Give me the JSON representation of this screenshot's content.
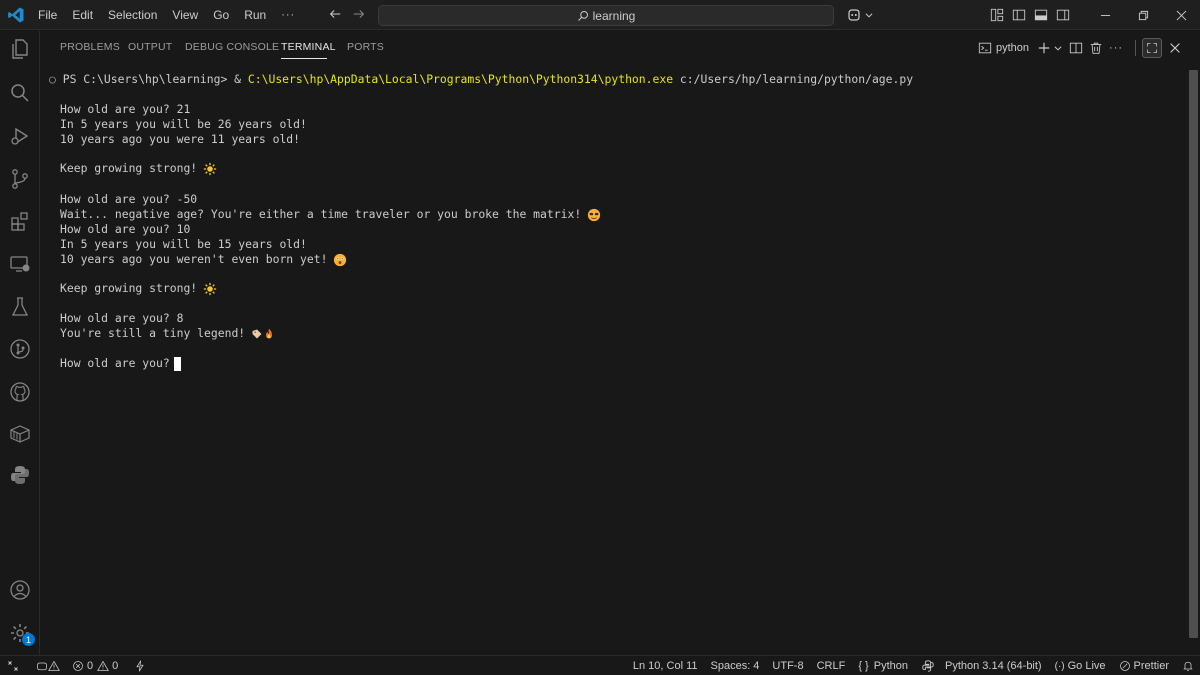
{
  "menu": [
    "File",
    "Edit",
    "Selection",
    "View",
    "Go",
    "Run"
  ],
  "menu_more": "···",
  "search": {
    "text": "learning"
  },
  "panel": {
    "tabs": [
      "PROBLEMS",
      "OUTPUT",
      "DEBUG CONSOLE",
      "TERMINAL",
      "PORTS"
    ],
    "active_tab": "TERMINAL",
    "terminal_name": "python",
    "more": "···"
  },
  "terminal": {
    "prompt_prefix": "PS C:\\Users\\hp\\learning> & ",
    "prompt_exe": "C:\\Users\\hp\\AppData\\Local\\Programs\\Python\\Python314\\python.exe",
    "prompt_script": " c:/Users/hp/learning/python/age.py",
    "lines": [
      "How old are you? 21",
      "In 5 years you will be 26 years old!",
      "10 years ago you were 11 years old!",
      "Keep growing strong!",
      "How old are you? -50",
      "Wait... negative age? You're either a time traveler or you broke the matrix!",
      "How old are you? 10",
      "In 5 years you will be 15 years old!",
      "10 years ago you weren't even born yet!",
      "Keep growing strong!",
      "How old are you? 8",
      "You're still a tiny legend!",
      "How old are you?"
    ]
  },
  "statusbar": {
    "errors": "0",
    "warnings": "0",
    "position": "Ln 10, Col 11",
    "spaces": "Spaces: 4",
    "encoding": "UTF-8",
    "eol": "CRLF",
    "language": "Python",
    "interpreter": "Python 3.14 (64-bit)",
    "golive": "Go Live",
    "prettier": "Prettier"
  },
  "activity_badge": "1",
  "colors": {
    "accent": "#0078d4",
    "path_yellow": "#e5e510",
    "background": "#181818"
  }
}
